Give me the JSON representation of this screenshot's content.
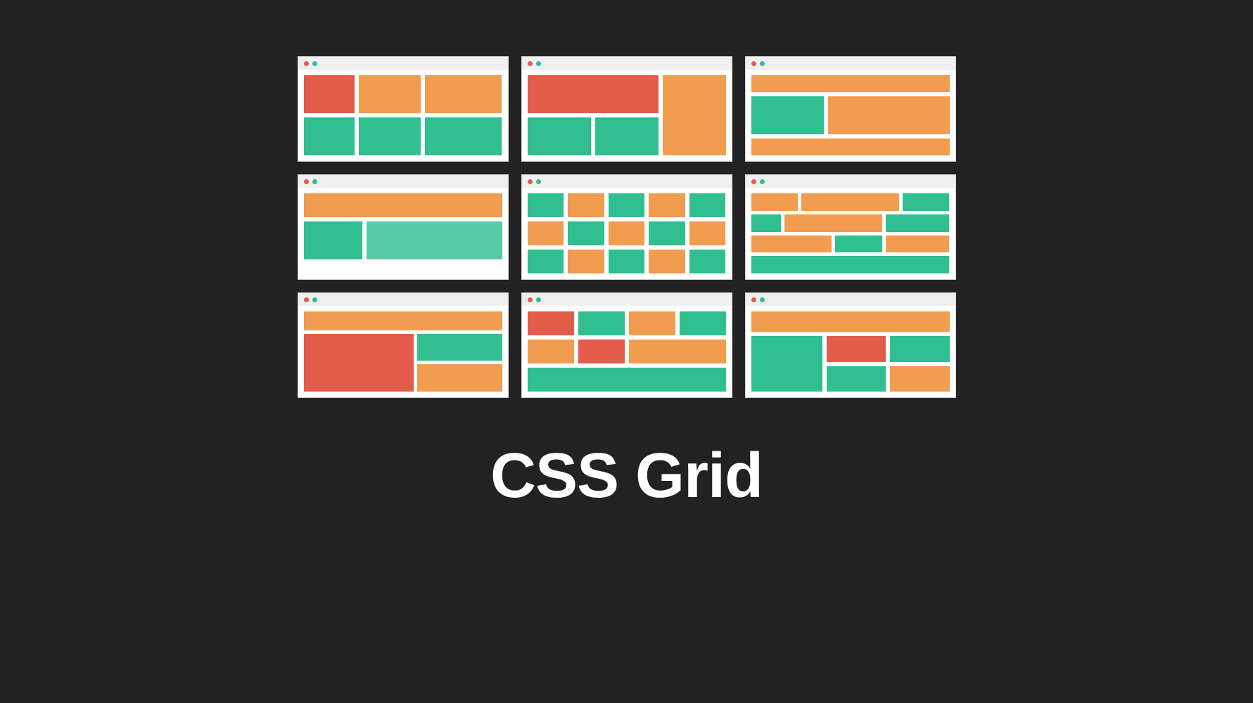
{
  "title": "CSS Grid",
  "colors": {
    "red": "#e25b4b",
    "orange": "#f29c50",
    "green": "#2fbf91",
    "teal": "#57c9a5",
    "dot_red": "#e25b4b",
    "dot_green": "#2fbf91"
  },
  "windows": [
    {
      "id": "w1",
      "blocks": [
        "red",
        "orange",
        "orange",
        "green",
        "green",
        "green"
      ]
    },
    {
      "id": "w2",
      "blocks_named": {
        "b1": "red",
        "b2": "orange",
        "b3": "green",
        "b4": "green"
      }
    },
    {
      "id": "w3",
      "blocks_named": {
        "b1": "orange",
        "b2": "green",
        "b3": "orange",
        "b4": "orange"
      }
    },
    {
      "id": "w4",
      "blocks_named": {
        "b1": "orange",
        "b2": "green",
        "b3": "teal"
      }
    },
    {
      "id": "w5",
      "blocks": [
        "green",
        "orange",
        "green",
        "orange",
        "green",
        "orange",
        "green",
        "orange",
        "green",
        "orange",
        "green",
        "orange",
        "green",
        "orange",
        "green"
      ]
    },
    {
      "id": "w6",
      "blocks_named": {
        "r1a": "orange",
        "r1b": "orange",
        "r1c": "green",
        "r2a": "green",
        "r2b": "orange",
        "r2c": "green",
        "r3a": "orange",
        "r3b": "green",
        "r3c": "orange",
        "r4a": "green"
      }
    },
    {
      "id": "w7",
      "blocks_named": {
        "top": "orange",
        "left": "red",
        "ra": "green",
        "rb": "orange"
      }
    },
    {
      "id": "w8",
      "blocks_named": {
        "a1": "red",
        "a2": "green",
        "a3": "orange",
        "a4": "green",
        "b1": "orange",
        "b2": "red",
        "b3": "orange",
        "c1": "green"
      }
    },
    {
      "id": "w9",
      "blocks_named": {
        "top": "orange",
        "left": "green",
        "ra": "red",
        "rb": "green",
        "rc": "green",
        "rd": "orange"
      }
    }
  ]
}
